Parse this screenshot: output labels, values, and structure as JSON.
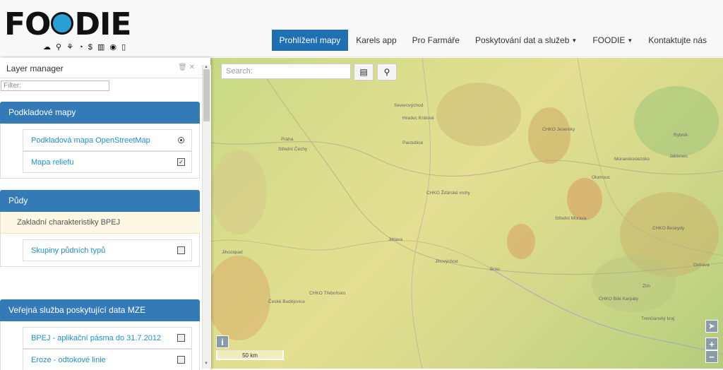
{
  "brand": {
    "logo_text": "FOODIE",
    "logo_pre": "FO",
    "logo_post": "DIE",
    "tagline_icons": "☁ ⚲ ⚘ ◔ $ ▥ ◉ ▯"
  },
  "nav": {
    "items": [
      {
        "label": "Prohlížení mapy",
        "active": true,
        "dropdown": false
      },
      {
        "label": "Karels app",
        "dropdown": false
      },
      {
        "label": "Pro Farmáře",
        "dropdown": false
      },
      {
        "label": "Poskytování dat a služeb",
        "dropdown": true
      },
      {
        "label": "FOODIE",
        "dropdown": true
      },
      {
        "label": "Kontaktujte nás",
        "dropdown": false
      }
    ],
    "accent": "#1f6fb2"
  },
  "layer_manager": {
    "title": "Layer manager",
    "filter_placeholder": "Filter:",
    "sections": [
      {
        "title": "Podkladové mapy",
        "items": [
          {
            "label": "Podkladová mapa OpenStreetMap",
            "control": "radio",
            "checked": true
          },
          {
            "label": "Mapa reliefu",
            "control": "checkbox",
            "checked": true
          }
        ]
      },
      {
        "title": "Půdy",
        "group": "Zakladní charakteristiky BPEJ",
        "items": [
          {
            "label": "Skupiny půdních typů",
            "control": "checkbox",
            "checked": false
          }
        ]
      },
      {
        "title": "Veřejná služba poskytující data MZE",
        "items": [
          {
            "label": "BPEJ - aplikační pásma do 31.7.2012",
            "control": "checkbox",
            "checked": false
          },
          {
            "label": "Eroze - odtokové linie",
            "control": "checkbox",
            "checked": false
          }
        ]
      }
    ]
  },
  "map": {
    "search_placeholder": "Search:",
    "scale_label": "50 km",
    "info_label": "i",
    "zoom_in": "+",
    "zoom_out": "−",
    "places": [
      "Severovýchod",
      "Hradec Králové",
      "Praha",
      "Střední Čechy",
      "Pardubice",
      "CHKO Jeseníky",
      "CHKO Žďárské vrchy",
      "Jihlava",
      "Jihovýchod",
      "Brno",
      "Olomouc",
      "Střední Morava",
      "CHKO Beskydy",
      "České Budějovice",
      "CHKO Třeboňsko",
      "CHKO Bílé Karpaty",
      "Moravskoslezsko",
      "Jablonec",
      "Zlín",
      "Trenčianský kraj",
      "Ostrava",
      "Rybník",
      "Jihozápad"
    ]
  }
}
